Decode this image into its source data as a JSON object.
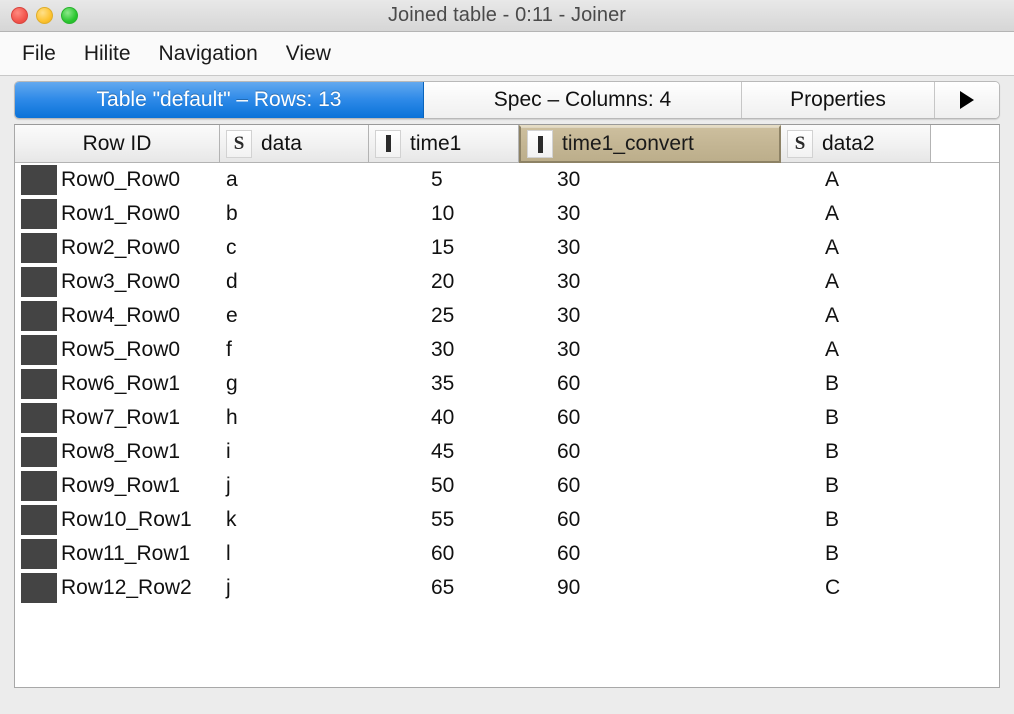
{
  "window": {
    "title": "Joined table - 0:11 - Joiner",
    "traffic_lights": [
      "close-button",
      "minimize-button",
      "zoom-button"
    ],
    "accent_selected_tab": "#0a72d8",
    "selected_column_header_color": "#c3b593",
    "row_swatch_color": "#444444"
  },
  "menubar": {
    "items": [
      {
        "label": "File"
      },
      {
        "label": "Hilite"
      },
      {
        "label": "Navigation"
      },
      {
        "label": "View"
      }
    ]
  },
  "tabs": {
    "items": [
      {
        "label": "Table \"default\" – Rows: 13",
        "active": true
      },
      {
        "label": "Spec – Columns: 4",
        "active": false
      },
      {
        "label": "Properties",
        "active": false
      }
    ],
    "scroll_right_icon": "triangle-right-icon"
  },
  "table": {
    "columns": [
      {
        "key": "rowid",
        "label": "Row ID",
        "type_icon": "",
        "selected": false
      },
      {
        "key": "data",
        "label": "data",
        "type_icon": "S",
        "type": "string",
        "selected": false
      },
      {
        "key": "time1",
        "label": "time1",
        "type_icon": "I",
        "type": "integer",
        "selected": false
      },
      {
        "key": "time1_convert",
        "label": "time1_convert",
        "type_icon": "I",
        "type": "integer",
        "selected": true
      },
      {
        "key": "data2",
        "label": "data2",
        "type_icon": "S",
        "type": "string",
        "selected": false
      }
    ],
    "rows": [
      {
        "rowid": "Row0_Row0",
        "data": "a",
        "time1": "5",
        "time1_convert": "30",
        "data2": "A"
      },
      {
        "rowid": "Row1_Row0",
        "data": "b",
        "time1": "10",
        "time1_convert": "30",
        "data2": "A"
      },
      {
        "rowid": "Row2_Row0",
        "data": "c",
        "time1": "15",
        "time1_convert": "30",
        "data2": "A"
      },
      {
        "rowid": "Row3_Row0",
        "data": "d",
        "time1": "20",
        "time1_convert": "30",
        "data2": "A"
      },
      {
        "rowid": "Row4_Row0",
        "data": "e",
        "time1": "25",
        "time1_convert": "30",
        "data2": "A"
      },
      {
        "rowid": "Row5_Row0",
        "data": "f",
        "time1": "30",
        "time1_convert": "30",
        "data2": "A"
      },
      {
        "rowid": "Row6_Row1",
        "data": "g",
        "time1": "35",
        "time1_convert": "60",
        "data2": "B"
      },
      {
        "rowid": "Row7_Row1",
        "data": "h",
        "time1": "40",
        "time1_convert": "60",
        "data2": "B"
      },
      {
        "rowid": "Row8_Row1",
        "data": "i",
        "time1": "45",
        "time1_convert": "60",
        "data2": "B"
      },
      {
        "rowid": "Row9_Row1",
        "data": "j",
        "time1": "50",
        "time1_convert": "60",
        "data2": "B"
      },
      {
        "rowid": "Row10_Row1",
        "data": "k",
        "time1": "55",
        "time1_convert": "60",
        "data2": "B"
      },
      {
        "rowid": "Row11_Row1",
        "data": "l",
        "time1": "60",
        "time1_convert": "60",
        "data2": "B"
      },
      {
        "rowid": "Row12_Row2",
        "data": "j",
        "time1": "65",
        "time1_convert": "90",
        "data2": "C"
      }
    ]
  }
}
